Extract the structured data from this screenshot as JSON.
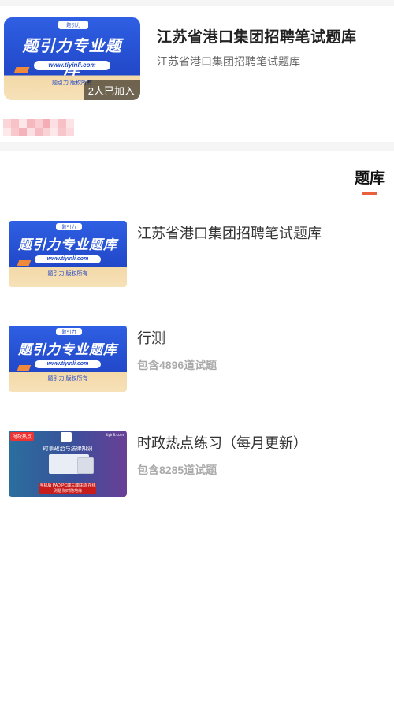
{
  "header": {
    "cover": {
      "pill_text": "题引力",
      "main_text": "题引力专业题库",
      "url_text": "www.tiyinli.com",
      "copyright_text": "题引力 版权所有"
    },
    "joined_badge": "2人已加入",
    "title": "江苏省港口集团招聘笔试题库",
    "subtitle": "江苏省港口集团招聘笔试题库"
  },
  "section_tab": {
    "label": "题库",
    "accent_color": "#e8603c"
  },
  "items": [
    {
      "title": "江苏省港口集团招聘笔试题库",
      "count": "",
      "cover": {
        "type": "blue",
        "pill_text": "题引力",
        "main_text": "题引力专业题库",
        "url_text": "www.tiyinli.com",
        "copyright_text": "题引力 版权所有"
      }
    },
    {
      "title": "行测",
      "count": "包含4896道试题",
      "cover": {
        "type": "blue",
        "pill_text": "题引力",
        "main_text": "题引力专业题库",
        "url_text": "www.tiyinli.com",
        "copyright_text": "题引力 版权所有"
      }
    },
    {
      "title": "时政热点练习（每月更新）",
      "count": "包含8285道试题",
      "cover": {
        "type": "news",
        "tag_text": "时政热点",
        "site_text": "tiyinli.com",
        "headline_text": "时事政治与法律知识",
        "banner_text": "手机版 PAD PC端三端联动 在线刷题 随时随地练"
      }
    }
  ],
  "colors": {
    "accent": "#e8603c",
    "cover_blue": "#2148c8"
  }
}
